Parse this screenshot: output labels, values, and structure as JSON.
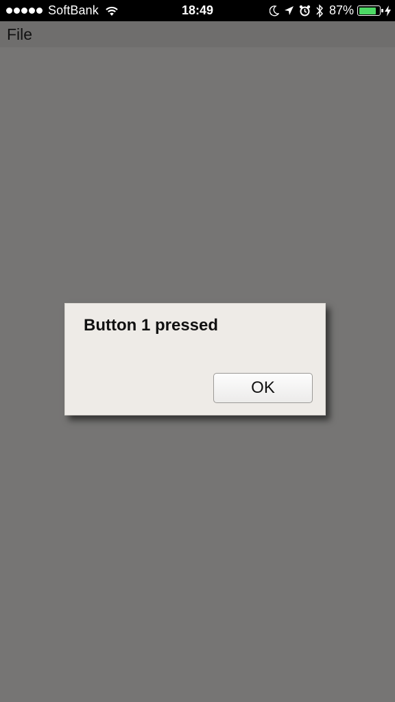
{
  "status_bar": {
    "carrier": "SoftBank",
    "time": "18:49",
    "battery_percent": "87%",
    "battery_level": 0.87,
    "icons": [
      "signal-dots-icon",
      "wifi-icon",
      "moon-icon",
      "location-arrow-icon",
      "alarm-icon",
      "bluetooth-icon",
      "battery-icon",
      "charging-bolt-icon"
    ],
    "battery_color": "#4cd964"
  },
  "menu": {
    "file_label": "File"
  },
  "dialog": {
    "message": "Button 1 pressed",
    "ok_label": "OK"
  },
  "colors": {
    "background": "#767574",
    "dialog_background": "#eeebe7"
  }
}
